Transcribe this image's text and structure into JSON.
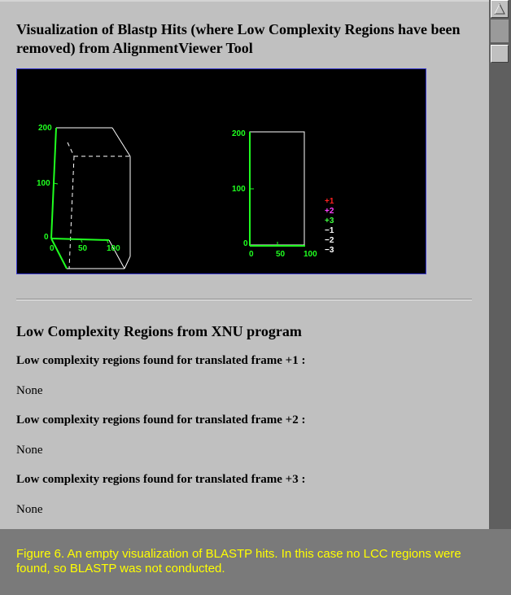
{
  "page": {
    "main_heading": "Visualization of Blastp Hits (where Low Complexity Regions have been removed) from AlignmentViewer Tool",
    "lcr_heading": "Low Complexity Regions from XNU program",
    "frames": [
      {
        "label": "Low complexity regions found for translated frame +1 :",
        "value": "None"
      },
      {
        "label": "Low complexity regions found for translated frame +2 :",
        "value": "None"
      },
      {
        "label": "Low complexity regions found for translated frame +3 :",
        "value": "None"
      }
    ]
  },
  "visualization": {
    "plot3d": {
      "z_ticks": [
        "0",
        "100",
        "200"
      ],
      "x_ticks": [
        "0",
        "50",
        "100"
      ]
    },
    "plot2d": {
      "y_ticks": [
        "0",
        "100",
        "200"
      ],
      "x_ticks": [
        "0",
        "50",
        "100"
      ]
    },
    "legend": [
      {
        "label": "+1",
        "color": "#ff2020"
      },
      {
        "label": "+2",
        "color": "#ff40ff"
      },
      {
        "label": "+3",
        "color": "#40ff40"
      },
      {
        "label": "−1",
        "color": "#ffffff"
      },
      {
        "label": "−2",
        "color": "#ffffff"
      },
      {
        "label": "−3",
        "color": "#ffffff"
      }
    ],
    "axis_color": "#20ff20",
    "box_color": "#ffffff"
  },
  "caption": {
    "text": "Figure 6.  An empty visualization of BLASTP hits.  In this case no LCC regions were found, so BLASTP was not conducted.",
    "color": "#ffff00"
  }
}
